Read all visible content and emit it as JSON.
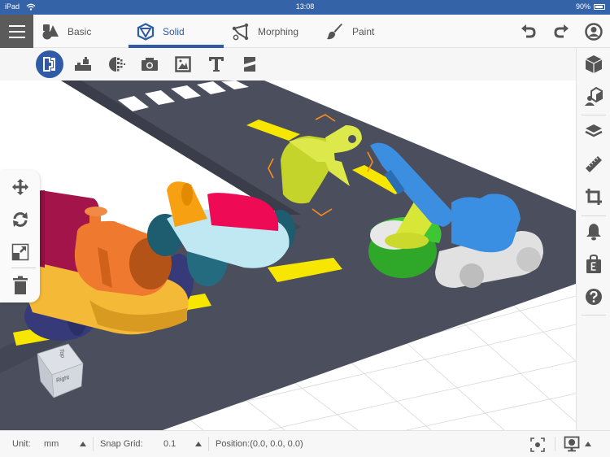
{
  "status_bar": {
    "device": "iPad",
    "time": "13:08",
    "battery": "90%",
    "wifi_icon": "wifi-icon",
    "battery_icon": "battery-icon"
  },
  "top_nav": {
    "menu_icon": "hamburger-menu-icon",
    "tabs": [
      {
        "label": "Basic",
        "icon": "basic-shapes-icon",
        "active": false
      },
      {
        "label": "Solid",
        "icon": "solid-cube-icon",
        "active": true
      },
      {
        "label": "Morphing",
        "icon": "morphing-icon",
        "active": false
      },
      {
        "label": "Paint",
        "icon": "paint-brush-icon",
        "active": false
      }
    ],
    "actions": [
      {
        "name": "undo",
        "icon": "undo-icon"
      },
      {
        "name": "redo",
        "icon": "redo-icon"
      },
      {
        "name": "account",
        "icon": "user-icon"
      }
    ],
    "accent_color": "#2f5ba6"
  },
  "sub_toolbar": {
    "tools": [
      {
        "name": "group",
        "icon": "group-object-icon",
        "active": true
      },
      {
        "name": "blocks",
        "icon": "blocks-icon",
        "active": false
      },
      {
        "name": "pixelate",
        "icon": "pixelate-icon",
        "active": false
      },
      {
        "name": "camera",
        "icon": "camera-icon",
        "active": false
      },
      {
        "name": "image",
        "icon": "image-icon",
        "active": false
      },
      {
        "name": "text",
        "icon": "text-icon",
        "active": false
      },
      {
        "name": "slice",
        "icon": "slice-icon",
        "active": false
      }
    ]
  },
  "right_sidebar": {
    "tools": [
      {
        "name": "object",
        "icon": "cube-icon"
      },
      {
        "name": "import-model",
        "icon": "cube-user-icon"
      },
      {
        "name": "layers",
        "icon": "layers-icon"
      },
      {
        "name": "measure",
        "icon": "ruler-icon"
      },
      {
        "name": "crop",
        "icon": "crop-icon"
      },
      {
        "name": "notifications",
        "icon": "bell-icon"
      },
      {
        "name": "store",
        "icon": "shopping-bag-icon"
      },
      {
        "name": "help",
        "icon": "help-icon"
      }
    ]
  },
  "left_panel": {
    "tools": [
      {
        "name": "move",
        "icon": "move-icon"
      },
      {
        "name": "rotate",
        "icon": "rotate-icon"
      },
      {
        "name": "scale",
        "icon": "scale-icon"
      },
      {
        "name": "delete",
        "icon": "trash-icon"
      }
    ]
  },
  "view_cube": {
    "top_label": "Top",
    "right_label": "Right"
  },
  "scene": {
    "objects": [
      "train",
      "race-car",
      "excavator",
      "road"
    ],
    "selected": "excavator-bucket"
  },
  "bottom_bar": {
    "unit_label": "Unit:",
    "unit_value": "mm",
    "snap_label": "Snap Grid:",
    "snap_value": "0.1",
    "position_text": "Position:(0.0, 0.0, 0.0)",
    "focus_icon": "focus-target-icon",
    "view_mode_icon": "display-mode-icon"
  }
}
